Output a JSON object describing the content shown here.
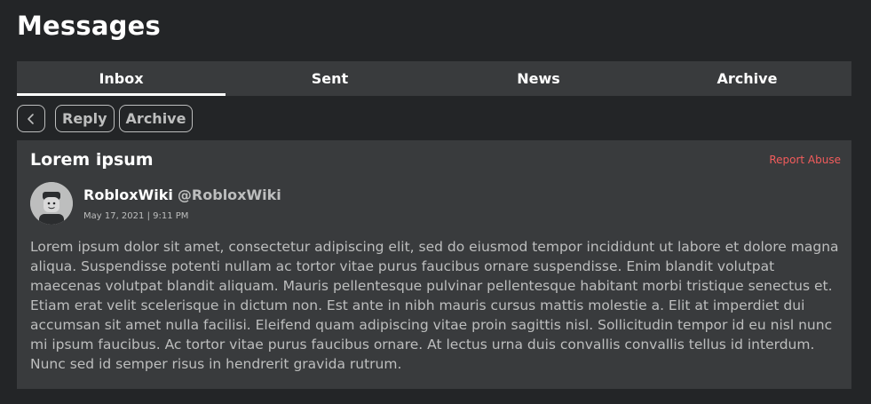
{
  "page": {
    "title": "Messages"
  },
  "tabs": [
    {
      "label": "Inbox",
      "active": true
    },
    {
      "label": "Sent",
      "active": false
    },
    {
      "label": "News",
      "active": false
    },
    {
      "label": "Archive",
      "active": false
    }
  ],
  "toolbar": {
    "back_icon": "chevron-left-icon",
    "reply_label": "Reply",
    "archive_label": "Archive"
  },
  "message": {
    "subject": "Lorem ipsum",
    "report_label": "Report Abuse",
    "sender_name": "RobloxWiki",
    "sender_handle": "@RobloxWiki",
    "date": "May 17, 2021 | 9:11 PM",
    "body": "Lorem ipsum dolor sit amet, consectetur adipiscing elit, sed do eiusmod tempor incididunt ut labore et dolore magna aliqua. Suspendisse potenti nullam ac tortor vitae purus faucibus ornare suspendisse. Enim blandit volutpat maecenas volutpat blandit aliquam. Mauris pellentesque pulvinar pellentesque habitant morbi tristique senectus et. Etiam erat velit scelerisque in dictum non. Est ante in nibh mauris cursus mattis molestie a. Elit at imperdiet dui accumsan sit amet nulla facilisi. Eleifend quam adipiscing vitae proin sagittis nisl. Sollicitudin tempor id eu nisl nunc mi ipsum faucibus. Ac tortor vitae purus faucibus ornare. At lectus urna duis convallis convallis tellus id interdum. Nunc sed id semper risus in hendrerit gravida rutrum."
  },
  "colors": {
    "background": "#232527",
    "panel": "#393b3d",
    "text": "#ffffff",
    "muted_text": "#bdbebe",
    "report": "#f25c5c"
  }
}
